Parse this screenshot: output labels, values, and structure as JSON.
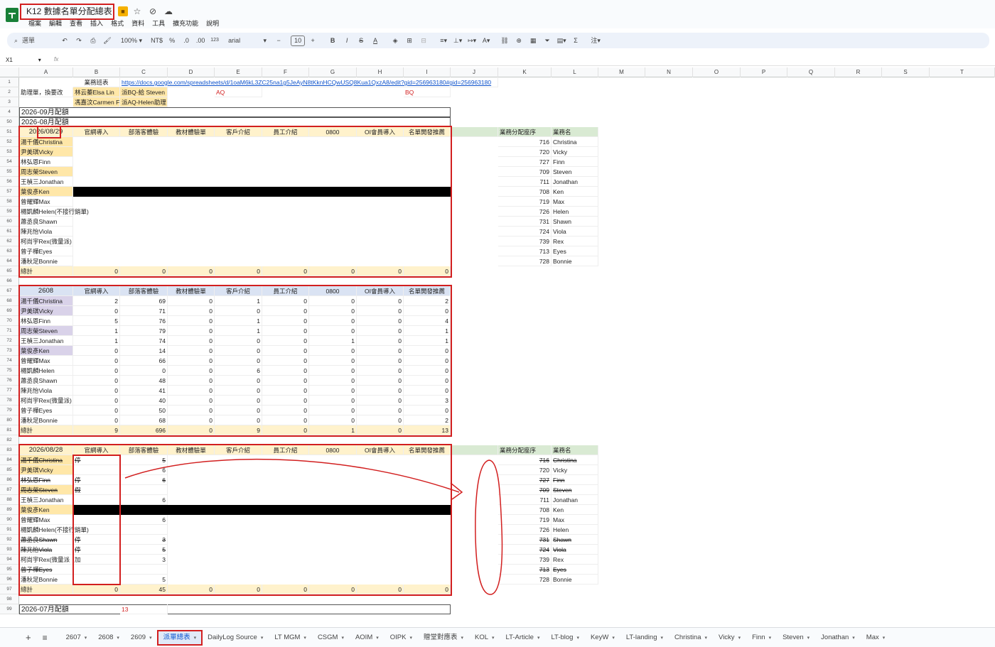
{
  "doc": {
    "title": "K12 數據名單分配總表",
    "menus": [
      "檔案",
      "編輯",
      "查看",
      "插入",
      "格式",
      "資料",
      "工具",
      "擴充功能",
      "說明"
    ]
  },
  "toolbar": {
    "search_label": "選單",
    "zoom": "100%",
    "currency": "NT$",
    "percent": "%",
    "dec_less": ".0",
    "dec_more": ".00",
    "num_format": "123",
    "font": "arial",
    "font_size": "10",
    "bold": "B",
    "italic": "I",
    "strike": "S",
    "text_color": "A"
  },
  "formula": {
    "cell": "X1",
    "fx": "fx"
  },
  "columns": [
    "A",
    "B",
    "C",
    "D",
    "E",
    "F",
    "G",
    "H",
    "I",
    "J",
    "K",
    "L",
    "M",
    "N",
    "O",
    "P",
    "Q",
    "R",
    "S",
    "T"
  ],
  "header_rows": {
    "r1_b": "業務班表",
    "r1_link": "https://docs.google.com/spreadsheets/d/1oaM6kL3ZC25na1g5JeAyN8tKknHCQwUSQ8Kua1QxzA8/edit?gid=256963180#gid=256963180",
    "r2_a": "助理單，換要改",
    "r2_b": "林云蓁Elsa Lin",
    "r2_c": "派BQ-給 Steven",
    "r2_e": "AQ",
    "r2_i": "BQ",
    "r3_b": "馮嘉汶Carmen F",
    "r3_c": "派AQ-Helen助理",
    "r4": "2026-09月配額",
    "r50": "2026-08月配額",
    "r99": "2026-07月配額",
    "r99_c": "13"
  },
  "metric_headers": [
    "官網導入",
    "部落客體驗",
    "教材體驗單",
    "客戶介紹",
    "員工介紹",
    "0800",
    "OI會員導入",
    "名單開發推薦"
  ],
  "staff_headers": {
    "seq": "業務分配座序",
    "name": "業務名"
  },
  "total_label": "總計",
  "block1": {
    "date": "2026/08/29",
    "names": [
      "湯千儀Christina",
      "尹美琪Vicky",
      "林弘恩Finn",
      "周志榮Steven",
      "王楨三Jonathan",
      "葉俊彥Ken",
      "曾耀輝Max",
      "楊凱麟Helen(不接行銷單)",
      "蕭丞良Shawn",
      "陳兆怡Viola",
      "柯尚宇Rex(微量派)",
      "曾子樺Eyes",
      "潘秋足Bonnie"
    ],
    "totals": [
      "0",
      "0",
      "0",
      "0",
      "0",
      "0",
      "0",
      "0"
    ],
    "staff": [
      [
        "716",
        "Christina"
      ],
      [
        "720",
        "Vicky"
      ],
      [
        "727",
        "Finn"
      ],
      [
        "709",
        "Steven"
      ],
      [
        "711",
        "Jonathan"
      ],
      [
        "708",
        "Ken"
      ],
      [
        "719",
        "Max"
      ],
      [
        "726",
        "Helen"
      ],
      [
        "731",
        "Shawn"
      ],
      [
        "724",
        "Viola"
      ],
      [
        "739",
        "Rex"
      ],
      [
        "713",
        "Eyes"
      ],
      [
        "728",
        "Bonnie"
      ]
    ]
  },
  "block2": {
    "date": "2608",
    "names": [
      "湯千儀Christina",
      "尹美琪Vicky",
      "林弘恩Finn",
      "周志榮Steven",
      "王楨三Jonathan",
      "葉俊彥Ken",
      "曾耀輝Max",
      "楊凱麟Helen",
      "蕭丞良Shawn",
      "陳兆怡Viola",
      "柯尚宇Rex(微量派)",
      "曾子樺Eyes",
      "潘秋足Bonnie"
    ],
    "values": [
      [
        "2",
        "69",
        "0",
        "1",
        "0",
        "0",
        "0",
        "2"
      ],
      [
        "0",
        "71",
        "0",
        "0",
        "0",
        "0",
        "0",
        "0"
      ],
      [
        "5",
        "76",
        "0",
        "1",
        "0",
        "0",
        "0",
        "4"
      ],
      [
        "1",
        "79",
        "0",
        "1",
        "0",
        "0",
        "0",
        "1"
      ],
      [
        "1",
        "74",
        "0",
        "0",
        "0",
        "1",
        "0",
        "1"
      ],
      [
        "0",
        "14",
        "0",
        "0",
        "0",
        "0",
        "0",
        "0"
      ],
      [
        "0",
        "66",
        "0",
        "0",
        "0",
        "0",
        "0",
        "0"
      ],
      [
        "0",
        "0",
        "0",
        "6",
        "0",
        "0",
        "0",
        "0"
      ],
      [
        "0",
        "48",
        "0",
        "0",
        "0",
        "0",
        "0",
        "0"
      ],
      [
        "0",
        "41",
        "0",
        "0",
        "0",
        "0",
        "0",
        "0"
      ],
      [
        "0",
        "40",
        "0",
        "0",
        "0",
        "0",
        "0",
        "3"
      ],
      [
        "0",
        "50",
        "0",
        "0",
        "0",
        "0",
        "0",
        "0"
      ],
      [
        "0",
        "68",
        "0",
        "0",
        "0",
        "0",
        "0",
        "2"
      ]
    ],
    "totals": [
      "9",
      "696",
      "0",
      "9",
      "0",
      "1",
      "0",
      "13"
    ]
  },
  "block3": {
    "date": "2026/08/28",
    "names": [
      "湯千儀Christina",
      "尹美琪Vicky",
      "林弘恩Finn",
      "周志榮Steven",
      "王楨三Jonathan",
      "葉俊彥Ken",
      "曾耀輝Max",
      "楊凱麟Helen(不接行銷單)",
      "蕭丞良Shawn",
      "陳兆怡Viola",
      "柯尚宇Rex(微量派",
      "曾子樺Eyes",
      "潘秋足Bonnie"
    ],
    "b": [
      "停",
      "",
      "停",
      "假",
      "",
      "",
      "",
      "",
      "停",
      "停",
      "加",
      "",
      ""
    ],
    "c": [
      "5",
      "6",
      "6",
      "",
      "6",
      "",
      "6",
      "",
      "3",
      "5",
      "3",
      "",
      "5"
    ],
    "totals": [
      "0",
      "45",
      "0",
      "0",
      "0",
      "0",
      "0",
      "0"
    ],
    "staff": [
      [
        "716",
        "Christina"
      ],
      [
        "720",
        "Vicky"
      ],
      [
        "727",
        "Finn"
      ],
      [
        "709",
        "Steven"
      ],
      [
        "711",
        "Jonathan"
      ],
      [
        "708",
        "Ken"
      ],
      [
        "719",
        "Max"
      ],
      [
        "726",
        "Helen"
      ],
      [
        "731",
        "Shawn"
      ],
      [
        "724",
        "Viola"
      ],
      [
        "739",
        "Rex"
      ],
      [
        "713",
        "Eyes"
      ],
      [
        "728",
        "Bonnie"
      ]
    ]
  },
  "tabs": [
    "2607",
    "2608",
    "2609",
    "派單總表",
    "DailyLog Source",
    "LT MGM",
    "CSGM",
    "AOIM",
    "OIPK",
    "贈堂對應表",
    "KOL",
    "LT-Article",
    "LT-blog",
    "KeyW",
    "LT-landing",
    "Christina",
    "Vicky",
    "Finn",
    "Steven",
    "Jonathan",
    "Max"
  ],
  "active_tab": "派單總表",
  "colors": {
    "accent_red": "#d21f1f",
    "header_yellow": "#fff2cc",
    "header_blue": "#dae3f3",
    "name_yellow": "#ffe7a8",
    "name_purple": "#d9d2e9",
    "green": "#d9ead3",
    "link": "#1155cc"
  }
}
